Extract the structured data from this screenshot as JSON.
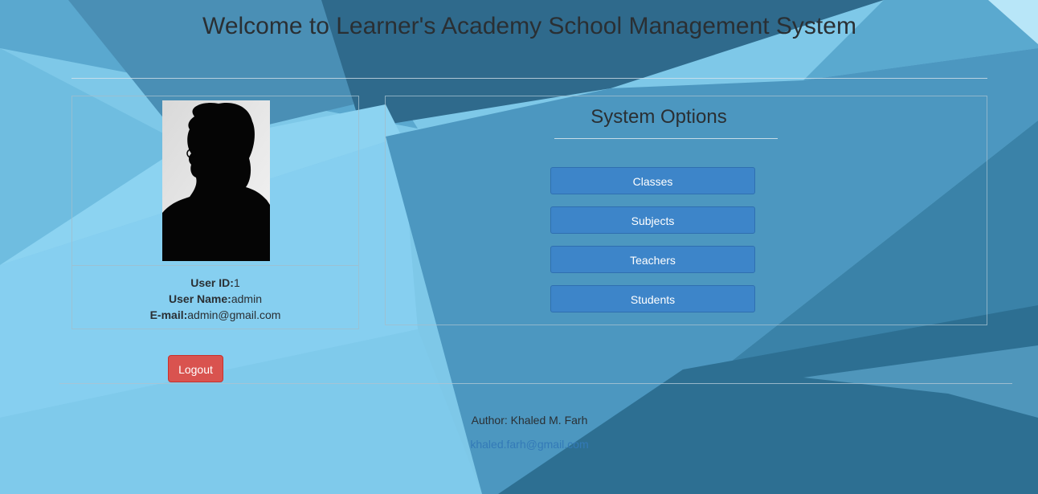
{
  "header": {
    "title": "Welcome to Learner's Academy School Management System"
  },
  "profile": {
    "avatar_icon": "user-silhouette-photo",
    "user_id_label": "User ID:",
    "user_id": "1",
    "user_name_label": "User Name:",
    "user_name": "admin",
    "email_label": "E-mail:",
    "email": "admin@gmail.com"
  },
  "options": {
    "title": "System Options",
    "buttons": [
      {
        "label": "Classes"
      },
      {
        "label": "Subjects"
      },
      {
        "label": "Teachers"
      },
      {
        "label": "Students"
      }
    ]
  },
  "logout": {
    "label": "Logout"
  },
  "footer": {
    "author": "Author: Khaled M. Farh",
    "email": "khaled.farh@gmail.com"
  },
  "colors": {
    "primary_button": "#3d85c9",
    "danger_button": "#d9534f",
    "link": "#337ab7",
    "background": "#7cc6e6"
  }
}
